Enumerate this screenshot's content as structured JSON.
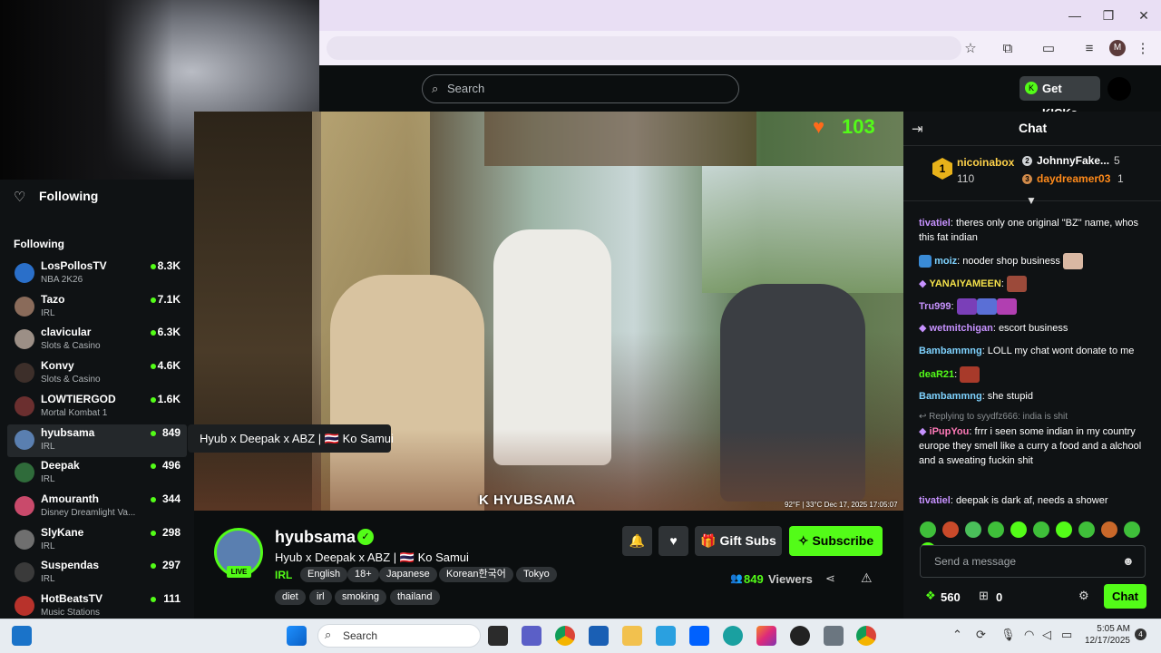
{
  "browser": {
    "window_controls": {
      "minimize": "—",
      "maximize": "❐",
      "close": "✕"
    },
    "profile_initial": "M"
  },
  "site": {
    "search_placeholder": "Search",
    "get_kicks_label": "Get KICKs",
    "brand_color": "#53fc18"
  },
  "sidebar": {
    "top_label": "Following",
    "section_heading": "Following",
    "items": [
      {
        "name": "LosPollosTV",
        "category": "NBA 2K26",
        "viewers": "8.3K",
        "color": "#2a6fc9"
      },
      {
        "name": "Tazo",
        "category": "IRL",
        "viewers": "7.1K",
        "color": "#8a6b5a"
      },
      {
        "name": "clavicular",
        "category": "Slots & Casino",
        "viewers": "6.3K",
        "color": "#9c8f86"
      },
      {
        "name": "Konvy",
        "category": "Slots & Casino",
        "viewers": "4.6K",
        "color": "#3d2f2a"
      },
      {
        "name": "LOWTIERGOD",
        "category": "Mortal Kombat 1",
        "viewers": "1.6K",
        "color": "#6b2f2f"
      },
      {
        "name": "hyubsama",
        "category": "IRL",
        "viewers": "849",
        "color": "#5a7fb0"
      },
      {
        "name": "Deepak",
        "category": "IRL",
        "viewers": "496",
        "color": "#2f6b3a"
      },
      {
        "name": "Amouranth",
        "category": "Disney Dreamlight Va...",
        "viewers": "344",
        "color": "#c94a6b"
      },
      {
        "name": "SlyKane",
        "category": "IRL",
        "viewers": "298",
        "color": "#6f6f6f"
      },
      {
        "name": "Suspendas",
        "category": "IRL",
        "viewers": "297",
        "color": "#3a3a3a"
      },
      {
        "name": "HotBeatsTV",
        "category": "Music Stations",
        "viewers": "111",
        "color": "#b8322b"
      }
    ]
  },
  "video": {
    "heart_count": "103",
    "tooltip": "Hyub x Deepak x ABZ | 🇹🇭 Ko Samui",
    "watermark": "K HYUBSAMA",
    "weather": "92°F | 33°C   Dec 17, 2025   17:05:07"
  },
  "channel": {
    "name": "hyubsama",
    "live_badge": "LIVE",
    "title": "Hyub x Deepak x ABZ | 🇹🇭 Ko Samui",
    "category": "IRL",
    "tags_row1": [
      "English",
      "18+",
      "Japanese",
      "Korean한국어",
      "Tokyo"
    ],
    "tags_row2": [
      "diet",
      "irl",
      "smoking",
      "thailand"
    ],
    "gift_subs_label": "Gift Subs",
    "subscribe_label": "Subscribe",
    "viewers_count": "849",
    "viewers_label": "Viewers"
  },
  "chat": {
    "title": "Chat",
    "leaderboard": [
      {
        "rank": "1",
        "name": "nicoinabox",
        "value": "110"
      },
      {
        "rank": "2",
        "name": "JohnnyFake...",
        "value": "5"
      },
      {
        "rank": "3",
        "name": "daydreamer03",
        "value": "1"
      }
    ],
    "messages": [
      {
        "user": "tivatiel",
        "color": "#c792ff",
        "text": ": theres only one original \"BZ\" name, whos this fat indian"
      },
      {
        "user": "moiz",
        "color": "#7fd3ff",
        "text": ": nooder shop business"
      },
      {
        "user": "YANAIYAMEEN",
        "color": "#f5e24a",
        "text": ":"
      },
      {
        "user": "Tru999",
        "color": "#c792ff",
        "text": ":"
      },
      {
        "user": "wetmitchigan",
        "color": "#c792ff",
        "text": ": escort business"
      },
      {
        "user": "Bambammng",
        "color": "#7fd3ff",
        "text": ": LOLL my chat wont donate to me"
      },
      {
        "user": "deaR21",
        "color": "#53fc18",
        "text": ":"
      },
      {
        "user": "Bambammng",
        "color": "#7fd3ff",
        "text": ": she stupid"
      },
      {
        "user": "iPupYou",
        "color": "#ff7ab8",
        "text": ": frrr i seen some indian in my country europe they smell like a curry a food and a alchool and a sweating fuckin shit"
      },
      {
        "user": "tivatiel",
        "color": "#c792ff",
        "text": ": deepak is dark af, needs a shower"
      }
    ],
    "reply_to": "Replying to syydfz666: india is shit",
    "input_placeholder": "Send a message",
    "kicks_count": "560",
    "gift_count": "0",
    "send_label": "Chat"
  },
  "taskbar": {
    "search_label": "Search",
    "time": "5:05 AM",
    "date": "12/17/2025",
    "notification_count": "4"
  }
}
